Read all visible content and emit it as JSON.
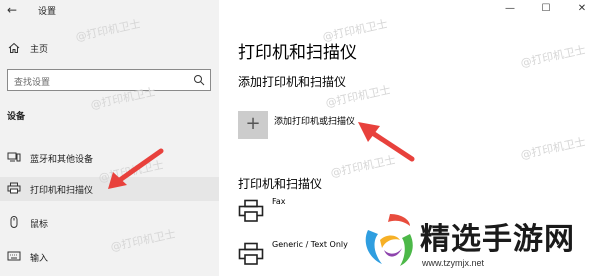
{
  "window": {
    "app_title": "设置",
    "controls": [
      "minimize-icon",
      "maximize-icon",
      "close-icon"
    ]
  },
  "sidebar": {
    "home_label": "主页",
    "search_placeholder": "查找设置",
    "section_title": "设备",
    "items": [
      {
        "label": "蓝牙和其他设备",
        "icon": "bluetooth-devices-icon"
      },
      {
        "label": "打印机和扫描仪",
        "icon": "printer-icon",
        "active": true
      },
      {
        "label": "鼠标",
        "icon": "mouse-icon"
      },
      {
        "label": "输入",
        "icon": "keyboard-icon"
      }
    ]
  },
  "main": {
    "title": "打印机和扫描仪",
    "add_section_title": "添加打印机和扫描仪",
    "add_button_label": "添加打印机或扫描仪",
    "printers_section_title": "打印机和扫描仪",
    "printers": [
      {
        "name": "Fax"
      },
      {
        "name": "Generic / Text Only"
      }
    ]
  },
  "watermark": {
    "text": "@打印机卫士"
  },
  "logo": {
    "text": "精选手游网",
    "url": "www.tzymjx.net"
  },
  "colors": {
    "sidebar_bg": "#f2f2f2",
    "active_item_bg": "#e6e6e6",
    "arrow_red": "#e8413c",
    "add_button_bg": "#cccccc"
  }
}
